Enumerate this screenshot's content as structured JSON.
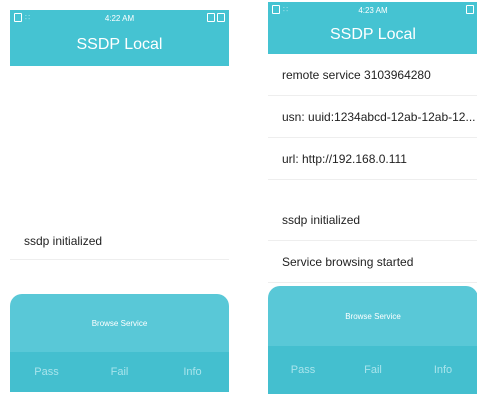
{
  "left_screen": {
    "status_time": "4:22 AM",
    "title": "SSDP Local",
    "items": [
      "ssdp initialized"
    ],
    "browse_button": "Browse Service",
    "nav": [
      "Pass",
      "Fail",
      "Info"
    ]
  },
  "right_screen": {
    "status_time": "4:23 AM",
    "title": "SSDP Local",
    "items": [
      "remote service 3103964280",
      "usn: uuid:1234abcd-12ab-12ab-12...",
      "url: http://192.168.0.111",
      "ssdp initialized",
      "Service browsing started"
    ],
    "browse_button": "Browse Service",
    "nav": [
      "Pass",
      "Fail",
      "Info"
    ]
  },
  "colors": {
    "accent": "#45c3d2",
    "button": "#59c8d7",
    "nav_text": "#a8e4ec"
  }
}
